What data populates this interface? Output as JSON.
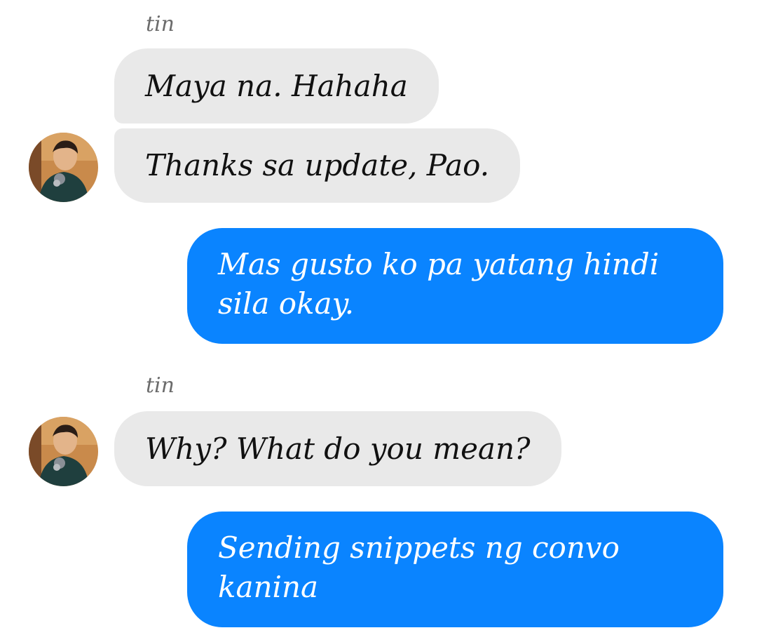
{
  "conversation": {
    "group_1": {
      "sender": "tin",
      "messages": [
        "Maya na. Hahaha",
        "Thanks sa update, Pao."
      ]
    },
    "outgoing_1": "Mas gusto ko pa yatang hindi sila okay.",
    "group_2": {
      "sender": "tin",
      "messages": [
        "Why? What do you mean?"
      ]
    },
    "outgoing_2": "Sending snippets ng convo kanina"
  },
  "colors": {
    "incoming_bubble": "#e9e9e9",
    "outgoing_bubble": "#0a84ff",
    "sender_name": "#6b6b6b"
  },
  "icons": {
    "avatar": "profile-photo"
  }
}
